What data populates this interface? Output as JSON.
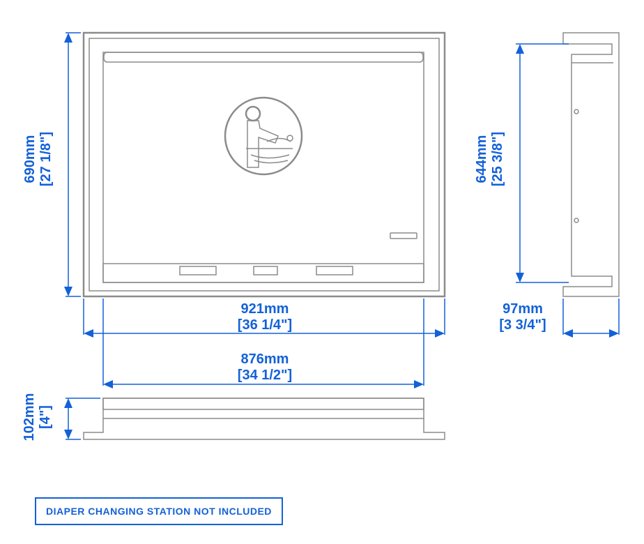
{
  "diagram": {
    "note": "DIAPER CHANGING STATION NOT INCLUDED",
    "dimensions": {
      "front_width": {
        "mm": "921mm",
        "in": "[36 1/4\"]"
      },
      "front_inner_width": {
        "mm": "876mm",
        "in": "[34 1/2\"]"
      },
      "front_height": {
        "mm": "690mm",
        "in": "[27 1/8\"]"
      },
      "side_height": {
        "mm": "644mm",
        "in": "[25 3/8\"]"
      },
      "side_depth": {
        "mm": "97mm",
        "in": "[3 3/4\"]"
      },
      "top_depth": {
        "mm": "102mm",
        "in": "[4\"]"
      }
    },
    "icon": "baby-changing-station-icon",
    "colors": {
      "accent": "#1361d8",
      "line": "#8b8b8b"
    }
  }
}
